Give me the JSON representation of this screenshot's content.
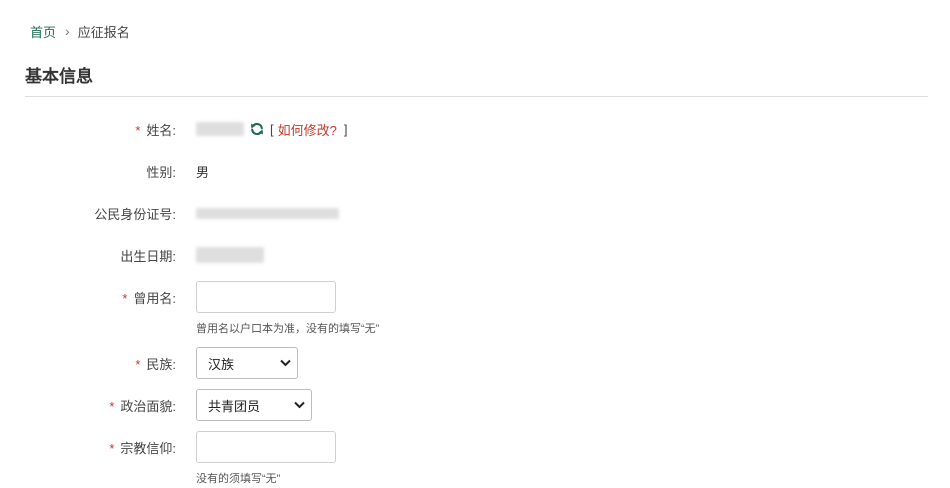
{
  "breadcrumb": {
    "home": "首页",
    "separator": "›",
    "current": "应征报名"
  },
  "section": {
    "title": "基本信息"
  },
  "form": {
    "name": {
      "required_mark": "*",
      "label": "姓名:",
      "bracket_open": "[",
      "modify_link": "如何修改?",
      "bracket_close": "]"
    },
    "gender": {
      "label": "性别:",
      "value": "男"
    },
    "id_number": {
      "label": "公民身份证号:"
    },
    "birth_date": {
      "label": "出生日期:"
    },
    "former_name": {
      "required_mark": "*",
      "label": "曾用名:",
      "value": "",
      "hint": "曾用名以户口本为准，没有的填写“无”"
    },
    "ethnicity": {
      "required_mark": "*",
      "label": "民族:",
      "selected": "汉族"
    },
    "political_status": {
      "required_mark": "*",
      "label": "政治面貌:",
      "selected": "共青团员"
    },
    "religion": {
      "required_mark": "*",
      "label": "宗教信仰:",
      "value": "",
      "hint": "没有的须填写“无”"
    }
  },
  "colors": {
    "accent_green": "#1f6a52",
    "required_red": "#c0392b",
    "link_red": "#c0392b"
  },
  "icons": {
    "refresh": "refresh-icon",
    "chevron": "chevron-down-icon",
    "breadcrumb_sep": "chevron-right-icon"
  }
}
